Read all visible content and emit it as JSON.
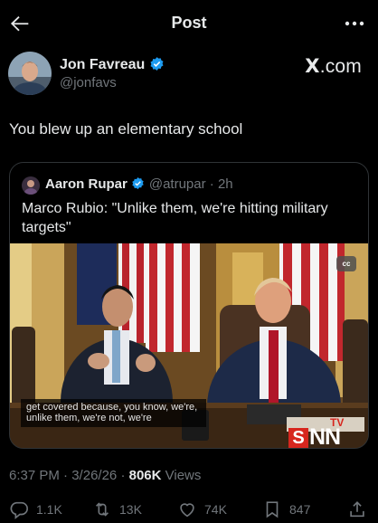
{
  "header": {
    "title": "Post",
    "back_icon": "back-arrow-icon",
    "more_icon": "more-dots-icon"
  },
  "post": {
    "author_name": "Jon Favreau",
    "author_handle": "@jonfavs",
    "source_logo": {
      "x_letter": "X",
      "suffix": ".com"
    },
    "text": "You blew up an elementary school"
  },
  "quote": {
    "author_name": "Aaron Rupar",
    "author_handle": "@atrupar",
    "time": "· 2h",
    "text": "Marco Rubio: \"Unlike them, we're hitting military targets\"",
    "video": {
      "cc_label": "cc",
      "caption_lines": [
        "get covered because, you know, we're,",
        "unlike them, we're not, we're"
      ],
      "watermark": {
        "s": "S",
        "nn": "NN",
        "tv": "TV"
      }
    }
  },
  "meta": {
    "time": "6:37 PM",
    "sep1": "·",
    "date": "3/26/26",
    "sep2": "·",
    "views_count": "806K",
    "views_label": "Views"
  },
  "actions": {
    "replies": "1.1K",
    "reposts": "13K",
    "likes": "74K",
    "bookmarks": "847"
  },
  "colors": {
    "background": "#000000",
    "text": "#e7e9ea",
    "secondary": "#71767b",
    "verified": "#1d9bf0",
    "snn_red": "#d7261e"
  }
}
